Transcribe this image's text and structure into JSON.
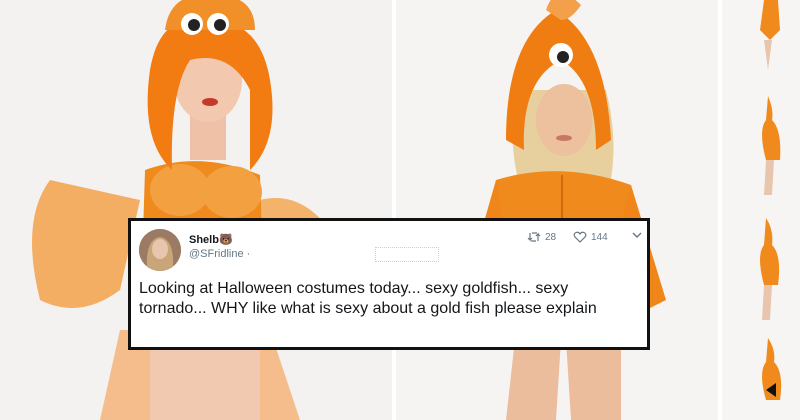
{
  "tweet": {
    "display_name": "Shelb",
    "name_emoji": "🐻",
    "handle": "@SFridline ·",
    "retweet_count": "28",
    "like_count": "144",
    "text": "Looking at Halloween costumes today... sexy goldfish... sexy tornado... WHY like what is sexy about a gold fish please explain"
  },
  "icons": [
    "retweet-icon",
    "heart-icon",
    "chevron-down-icon",
    "play-arrow-icon"
  ],
  "colors": {
    "costume_orange": "#f08a1c",
    "wig_orange": "#f27b12",
    "border": "#111111",
    "secondary_text": "#657786"
  }
}
